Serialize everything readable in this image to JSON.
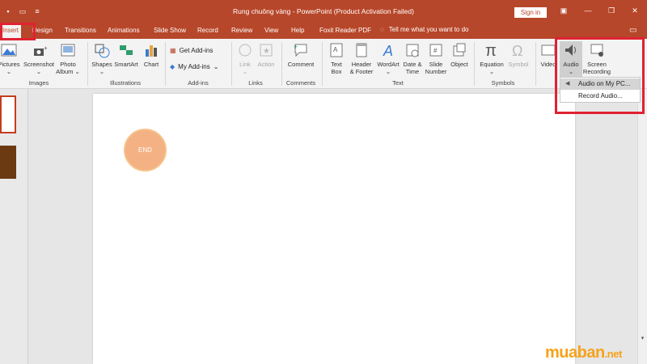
{
  "titlebar": {
    "title": "Rung chuông vàng  -  PowerPoint (Product Activation Failed)",
    "signin": "Sign in",
    "qat_icons": [
      "save-icon",
      "start-slideshow-icon",
      "customize-qat-icon"
    ]
  },
  "tabs": [
    {
      "label": "Insert",
      "active": true
    },
    {
      "label": "Design"
    },
    {
      "label": "Transitions"
    },
    {
      "label": "Animations"
    },
    {
      "label": "Slide Show"
    },
    {
      "label": "Record"
    },
    {
      "label": "Review"
    },
    {
      "label": "View"
    },
    {
      "label": "Help"
    },
    {
      "label": "Foxit Reader PDF"
    }
  ],
  "tellme": "Tell me what you want to do",
  "ribbon": {
    "images": {
      "pictures": "Pictures",
      "screenshot": "Screenshot",
      "photo_album_1": "Photo",
      "photo_album_2": "Album",
      "group": "Images"
    },
    "illustrations": {
      "shapes": "Shapes",
      "smartart": "SmartArt",
      "chart": "Chart",
      "group": "Illustrations"
    },
    "addins": {
      "get": "Get Add-ins",
      "my": "My Add-ins",
      "group": "Add-ins"
    },
    "links": {
      "link": "Link",
      "action": "Action",
      "group": "Links"
    },
    "comments": {
      "comment": "Comment",
      "group": "Comments"
    },
    "text": {
      "textbox_1": "Text",
      "textbox_2": "Box",
      "header_1": "Header",
      "header_2": "& Footer",
      "wordart": "WordArt",
      "datetime_1": "Date &",
      "datetime_2": "Time",
      "slidenum_1": "Slide",
      "slidenum_2": "Number",
      "object": "Object",
      "group": "Text"
    },
    "symbols": {
      "equation": "Equation",
      "symbol": "Symbol",
      "group": "Symbols"
    },
    "media": {
      "video": "Video",
      "audio": "Audio",
      "screen_rec_1": "Screen",
      "screen_rec_2": "Recording"
    }
  },
  "dropdown": {
    "items": [
      "Audio on My PC...",
      "Record Audio..."
    ]
  },
  "slide": {
    "shape_text": "END"
  },
  "watermark": {
    "main": "muaban",
    "suffix": ".net"
  },
  "colors": {
    "accent": "#b7472a",
    "highlight": "#e02231",
    "circle": "#f4b183"
  }
}
